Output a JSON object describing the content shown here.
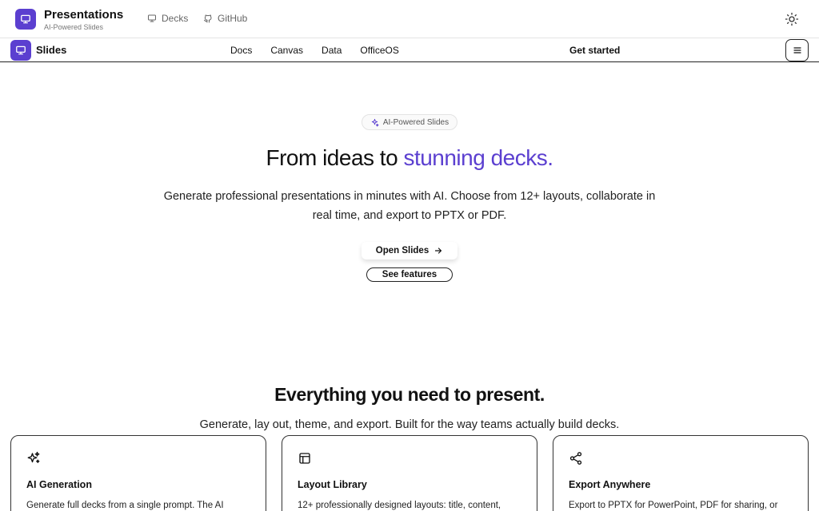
{
  "header": {
    "app_title": "Presentations",
    "app_subtitle": "AI-Powered Slides",
    "nav": [
      {
        "label": "Decks",
        "icon": "monitor-icon"
      },
      {
        "label": "GitHub",
        "icon": "github-icon"
      }
    ],
    "theme_icon": "sun-icon"
  },
  "subnav": {
    "brand": "Slides",
    "links": [
      "Docs",
      "Canvas",
      "Data",
      "OfficeOS"
    ],
    "cta": "Get started",
    "menu_icon": "hamburger-icon"
  },
  "hero": {
    "badge": "AI-Powered Slides",
    "title_start": "From ideas to ",
    "title_accent": "stunning decks.",
    "description": "Generate professional presentations in minutes with AI. Choose from 12+ layouts, collaborate in real time, and export to PPTX or PDF.",
    "primary_button": "Open Slides",
    "secondary_button": "See features"
  },
  "features": {
    "title": "Everything you need to present.",
    "description": "Generate, lay out, theme, and export. Built for the way teams actually build decks.",
    "cards": [
      {
        "title": "AI Generation",
        "description": "Generate full decks from a single prompt. The AI",
        "icon": "sparkles-icon"
      },
      {
        "title": "Layout Library",
        "description": "12+ professionally designed layouts: title, content,",
        "icon": "layout-icon"
      },
      {
        "title": "Export Anywhere",
        "description": "Export to PPTX for PowerPoint, PDF for sharing, or",
        "icon": "share-icon"
      }
    ]
  },
  "colors": {
    "accent": "#5b3fd0",
    "text": "#111111",
    "border": "#222222"
  }
}
